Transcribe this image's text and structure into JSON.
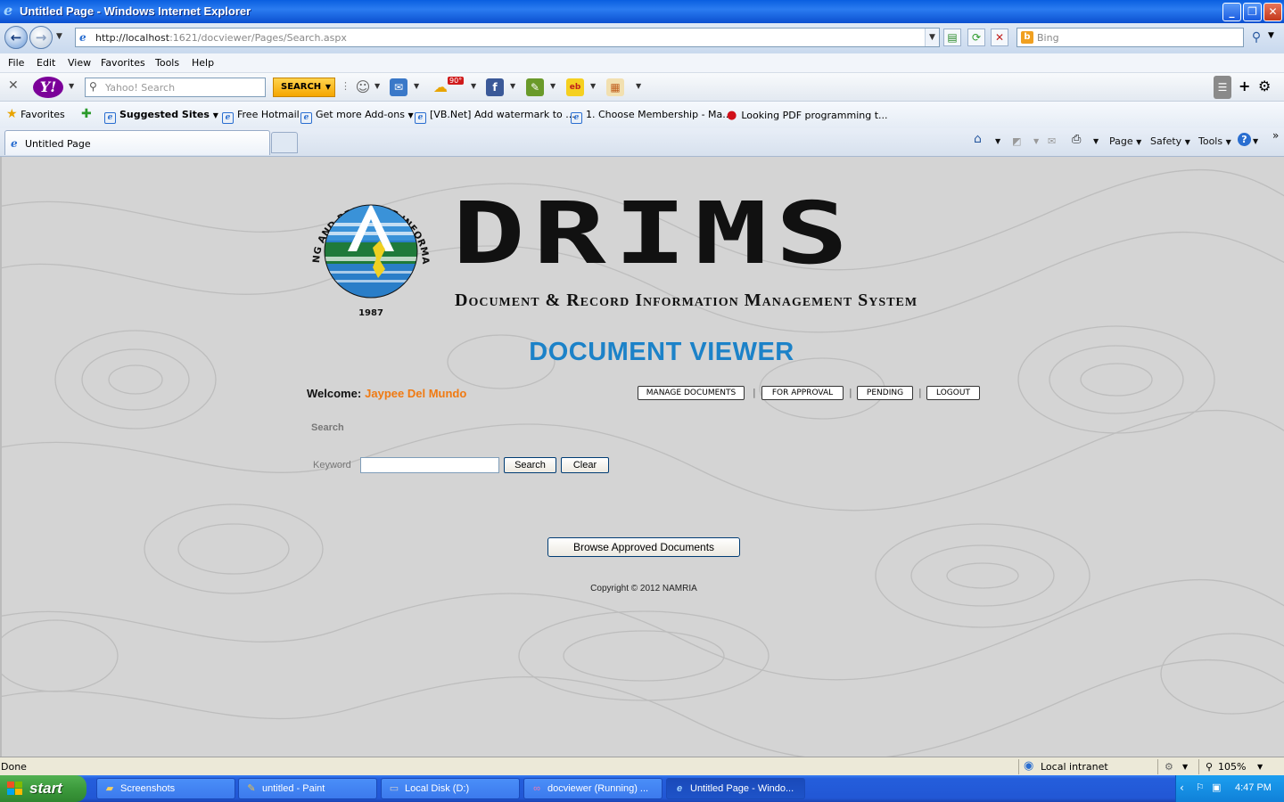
{
  "window": {
    "title": "Untitled Page - Windows Internet Explorer"
  },
  "address": {
    "url_host": "http://localhost",
    "url_rest": ":1621/docviewer/Pages/Search.aspx",
    "search_placeholder": "Bing"
  },
  "menu": [
    "File",
    "Edit",
    "View",
    "Favorites",
    "Tools",
    "Help"
  ],
  "yahoo_toolbar": {
    "search_placeholder": "Yahoo! Search",
    "search_button": "SEARCH",
    "weather_badge": "90°"
  },
  "favorites": {
    "label": "Favorites",
    "items": [
      "Suggested Sites",
      "Free Hotmail",
      "Get more Add-ons",
      "[VB.Net] Add watermark to ...",
      "1. Choose Membership - Ma...",
      "Looking PDF programming t..."
    ]
  },
  "tabs": [
    {
      "label": "Untitled Page"
    }
  ],
  "command_bar": {
    "page": "Page",
    "safety": "Safety",
    "tools": "Tools"
  },
  "page": {
    "logo": {
      "ring_text": "NATIONAL MAPPING AND RESOURCE INFORMATION AUTHORITY",
      "year": "1987"
    },
    "brand": "DRIMS",
    "brand_subtitle": "Document & Record Information Management System",
    "heading": "DOCUMENT VIEWER",
    "welcome_label": "Welcome:",
    "user_name": "Jaypee Del Mundo",
    "nav": {
      "manage": "MANAGE DOCUMENTS",
      "approval": "FOR APPROVAL",
      "pending": "PENDING",
      "logout": "LOGOUT"
    },
    "search_section": "Search",
    "keyword_label": "Keyword",
    "keyword_value": "",
    "search_button": "Search",
    "clear_button": "Clear",
    "browse_button": "Browse Approved Documents",
    "copyright": "Copyright © 2012 NAMRIA"
  },
  "status": {
    "text": "Done",
    "zone": "Local intranet",
    "zoom": "105%"
  },
  "taskbar": {
    "start": "start",
    "items": [
      "Screenshots",
      "untitled - Paint",
      "Local Disk (D:)",
      "docviewer (Running) ...",
      "Untitled Page - Windo..."
    ],
    "clock": "4:47 PM"
  },
  "colors": {
    "heading": "#1c82c8",
    "user_name": "#f07a12",
    "title_bar": "#0a5fe0",
    "taskbar": "#245edc",
    "start": "#3c9a3c"
  }
}
